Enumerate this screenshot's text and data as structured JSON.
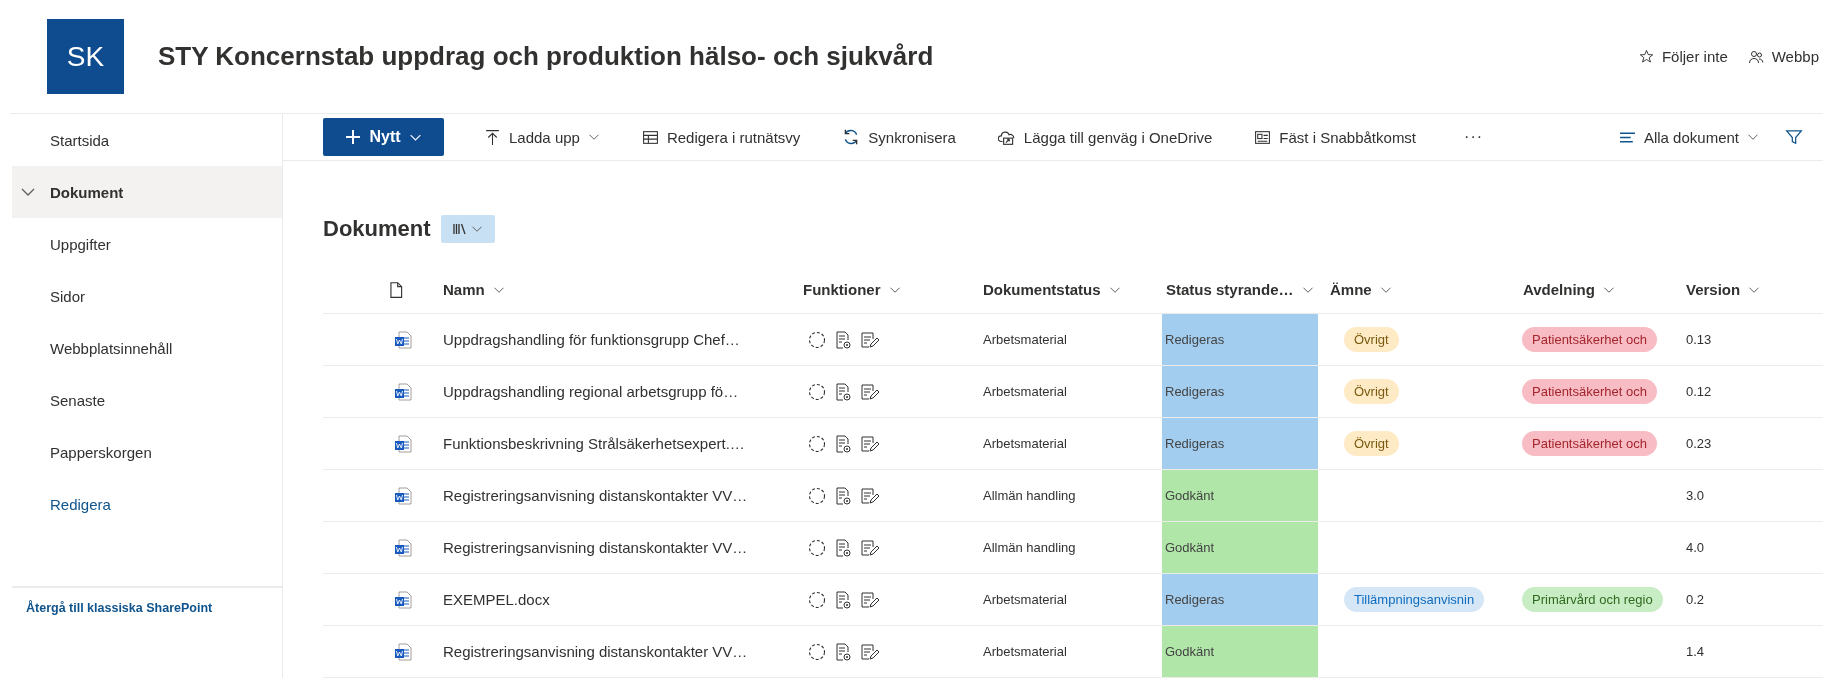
{
  "site": {
    "logo": "SK",
    "title": "STY Koncernstab uppdrag och produktion hälso- och sjukvård",
    "actions": [
      {
        "kind": "follow",
        "label": "Följer inte"
      },
      {
        "kind": "members",
        "label": "Webbp"
      }
    ]
  },
  "nav": {
    "items": [
      {
        "label": "Startsida",
        "kind": "page",
        "selected": false
      },
      {
        "label": "Dokument",
        "kind": "page",
        "selected": true,
        "expanded": true
      },
      {
        "label": "Uppgifter",
        "kind": "page",
        "selected": false
      },
      {
        "label": "Sidor",
        "kind": "page",
        "selected": false
      },
      {
        "label": "Webbplatsinnehåll",
        "kind": "page",
        "selected": false
      },
      {
        "label": "Senaste",
        "kind": "page",
        "selected": false
      },
      {
        "label": "Papperskorgen",
        "kind": "page",
        "selected": false
      },
      {
        "label": "Redigera",
        "kind": "link",
        "selected": false
      }
    ],
    "footer_link": "Återgå till klassiska SharePoint"
  },
  "toolbar": {
    "items": [
      {
        "kind": "new",
        "label": "Nytt",
        "dropdown": true
      },
      {
        "kind": "upload",
        "label": "Ladda upp",
        "dropdown": true
      },
      {
        "kind": "grid",
        "label": "Redigera i rutnätsvy",
        "dropdown": false
      },
      {
        "kind": "sync",
        "label": "Synkronisera",
        "dropdown": false
      },
      {
        "kind": "shortcut",
        "label": "Lägga till genväg i OneDrive",
        "dropdown": false
      },
      {
        "kind": "pin",
        "label": "Fäst i Snabbåtkomst",
        "dropdown": false
      },
      {
        "kind": "more",
        "label": "···"
      }
    ],
    "view": "Alla dokument"
  },
  "library": {
    "title": "Dokument",
    "columns": [
      {
        "kind": "type"
      },
      {
        "kind": "text",
        "label": "Namn"
      },
      {
        "kind": "text",
        "label": "Funktioner"
      },
      {
        "kind": "text",
        "label": "Dokumentstatus"
      },
      {
        "kind": "text",
        "label": "Status styrande…"
      },
      {
        "kind": "text",
        "label": "Ämne"
      },
      {
        "kind": "text",
        "label": "Avdelning"
      },
      {
        "kind": "text",
        "label": "Version"
      }
    ],
    "rows": [
      {
        "name": "Uppdragshandling för funktionsgrupp Chef…",
        "doc_status": "Arbetsmaterial",
        "status": {
          "label": "Redigeras",
          "color": "#a3cdef"
        },
        "subject": {
          "label": "Övrigt",
          "color": "#feeac4"
        },
        "department": {
          "label": "Patientsäkerhet och",
          "color": "#f8bcc5"
        },
        "version": "0.13"
      },
      {
        "name": "Uppdragshandling regional arbetsgrupp fö…",
        "doc_status": "Arbetsmaterial",
        "status": {
          "label": "Redigeras",
          "color": "#a3cdef"
        },
        "subject": {
          "label": "Övrigt",
          "color": "#feeac4"
        },
        "department": {
          "label": "Patientsäkerhet och",
          "color": "#f8bcc5"
        },
        "version": "0.12"
      },
      {
        "name": "Funktionsbeskrivning Strålsäkerhetsexpert.…",
        "doc_status": "Arbetsmaterial",
        "status": {
          "label": "Redigeras",
          "color": "#a3cdef"
        },
        "subject": {
          "label": "Övrigt",
          "color": "#feeac4"
        },
        "department": {
          "label": "Patientsäkerhet och",
          "color": "#f8bcc5"
        },
        "version": "0.23"
      },
      {
        "name": "Registreringsanvisning distanskontakter VV…",
        "doc_status": "Allmän handling",
        "status": {
          "label": "Godkänt",
          "color": "#b1e6a9"
        },
        "version": "3.0"
      },
      {
        "name": "Registreringsanvisning distanskontakter VV…",
        "doc_status": "Allmän handling",
        "status": {
          "label": "Godkänt",
          "color": "#b1e6a9"
        },
        "version": "4.0"
      },
      {
        "name": "EXEMPEL.docx",
        "doc_status": "Arbetsmaterial",
        "status": {
          "label": "Redigeras",
          "color": "#a3cdef"
        },
        "subject": {
          "label": "Tillämpningsanvisnin",
          "color": "#d5e7f7"
        },
        "department": {
          "label": "Primärvård och regio",
          "color": "#c8edc4"
        },
        "version": "0.2"
      },
      {
        "name": "Registreringsanvisning distanskontakter VV…",
        "doc_status": "Arbetsmaterial",
        "status": {
          "label": "Godkänt",
          "color": "#b1e6a9"
        },
        "version": "1.4"
      }
    ]
  }
}
